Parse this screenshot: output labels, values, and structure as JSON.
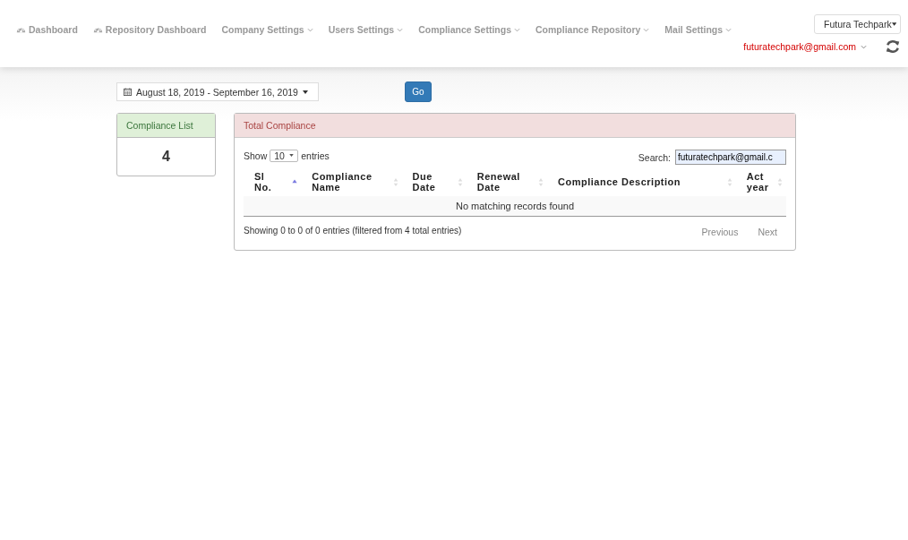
{
  "nav": [
    {
      "label": "Dashboard",
      "kind": "icon",
      "dropdown": false
    },
    {
      "label": "Repository Dashboard",
      "kind": "icon",
      "dropdown": false
    },
    {
      "label": "Company Settings",
      "kind": "menu",
      "dropdown": true
    },
    {
      "label": "Users Settings",
      "kind": "menu",
      "dropdown": true
    },
    {
      "label": "Compliance Settings",
      "kind": "menu",
      "dropdown": true
    },
    {
      "label": "Compliance Repository",
      "kind": "menu",
      "dropdown": true
    },
    {
      "label": "Mail Settings",
      "kind": "menu",
      "dropdown": true
    }
  ],
  "company_select": {
    "value": "Futura Techpark"
  },
  "user_menu": {
    "label": "futuratechpark@gmail.com"
  },
  "date_range": {
    "value": "August 18, 2019 - September 16, 2019"
  },
  "go_button": "Go",
  "summary_card": {
    "title": "Compliance List",
    "count": "4"
  },
  "panel": {
    "title": "Total Compliance",
    "length": {
      "prefix": "Show",
      "value": "10",
      "suffix": "entries"
    },
    "search": {
      "label": "Search:",
      "value": "futuratechpark@gmail.c"
    },
    "columns": [
      {
        "label": "Sl No.",
        "sorted": true
      },
      {
        "label": "Compliance Name",
        "sorted": false
      },
      {
        "label": "Due Date",
        "sorted": false
      },
      {
        "label": "Renewal Date",
        "sorted": false
      },
      {
        "label": "Compliance Description",
        "sorted": false
      },
      {
        "label": "Act year",
        "sorted": false
      }
    ],
    "empty_message": "No matching records found",
    "info": "Showing 0 to 0 of 0 entries (filtered from 4 total entries)",
    "pagination": [
      {
        "label": "Previous",
        "disabled": true
      },
      {
        "label": "Next",
        "disabled": true
      }
    ]
  }
}
